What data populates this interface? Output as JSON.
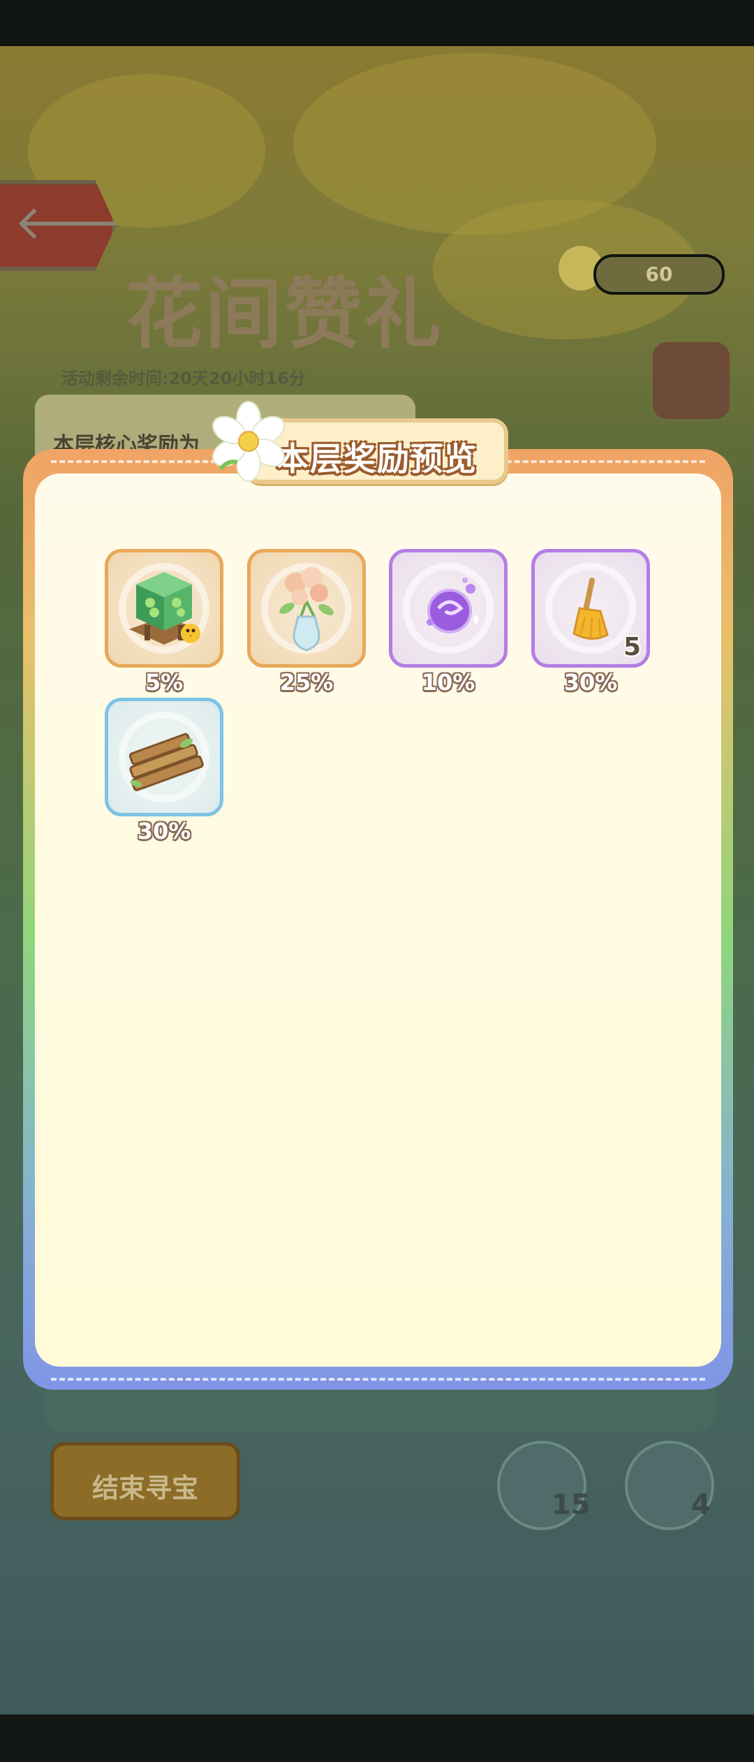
{
  "background": {
    "title": "花间赞礼",
    "timer": "活动剩余时间:20天20小时16分",
    "core_reward_label": "本层核心奖励为",
    "coin_count": "60",
    "end_button": "结束寻宝",
    "tool_count_1": "15",
    "tool_count_2": "4"
  },
  "modal": {
    "title": "本层奖励预览",
    "items": [
      {
        "name": "green-cube-furniture",
        "percent": "5%",
        "rarity": "orange",
        "count": ""
      },
      {
        "name": "flower-vase",
        "percent": "25%",
        "rarity": "orange",
        "count": ""
      },
      {
        "name": "purple-orb",
        "percent": "10%",
        "rarity": "purple",
        "count": ""
      },
      {
        "name": "broom",
        "percent": "30%",
        "rarity": "purple",
        "count": "5"
      },
      {
        "name": "wood-planks",
        "percent": "30%",
        "rarity": "blue",
        "count": ""
      }
    ]
  },
  "colors": {
    "rarity_orange": "#e8a85a",
    "rarity_purple": "#b57de6",
    "rarity_blue": "#7cc3e6",
    "title_outline": "#9b5a2c"
  }
}
